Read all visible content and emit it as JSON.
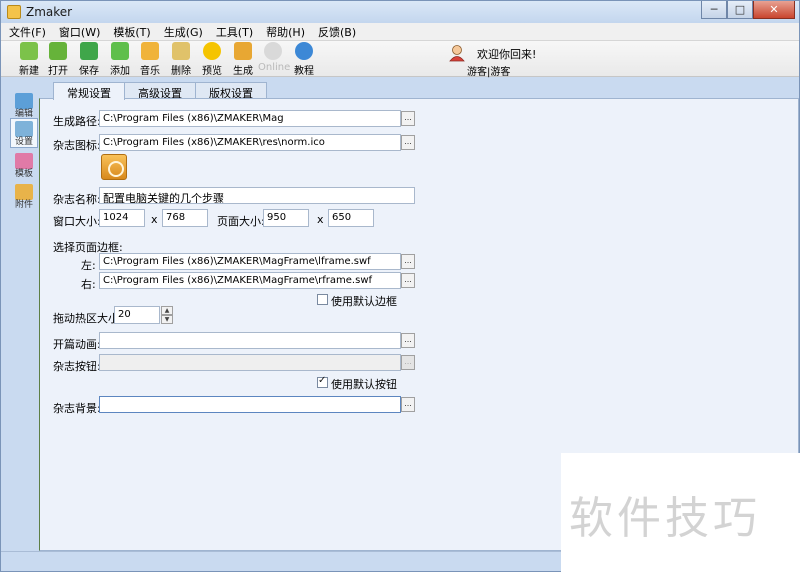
{
  "window": {
    "title": "Zmaker",
    "buttons": {
      "minimize": "─",
      "maximize": "□",
      "close": "✕"
    }
  },
  "menu": [
    "文件(F)",
    "窗口(W)",
    "模板(T)",
    "生成(G)",
    "工具(T)",
    "帮助(H)",
    "反馈(B)"
  ],
  "toolbar": [
    {
      "label": "新建",
      "icon": "new-icon",
      "color": "#7cc24a"
    },
    {
      "label": "打开",
      "icon": "open-icon",
      "color": "#66b33a"
    },
    {
      "label": "保存",
      "icon": "save-icon",
      "color": "#3fa64a"
    },
    {
      "label": "添加",
      "icon": "add-icon",
      "color": "#5fbf4c"
    },
    {
      "label": "音乐",
      "icon": "music-icon",
      "color": "#f0b33a"
    },
    {
      "label": "删除",
      "icon": "delete-icon",
      "color": "#e0c26a"
    },
    {
      "label": "预览",
      "icon": "star-icon",
      "color": "#f5c400"
    },
    {
      "label": "生成",
      "icon": "generate-icon",
      "color": "#e8a733"
    },
    {
      "label": "Online",
      "icon": "online-icon",
      "color": "#d9d9d9",
      "disabled": true
    },
    {
      "label": "教程",
      "icon": "help-icon",
      "color": "#3c88d6"
    }
  ],
  "user": {
    "welcome": "欢迎你回来!",
    "name": "游客|游客"
  },
  "sidebar": [
    {
      "label": "编辑",
      "icon": "edit-icon",
      "color": "#5c9fd8"
    },
    {
      "label": "设置",
      "icon": "settings-icon",
      "color": "#7eb2d9",
      "active": true
    },
    {
      "label": "模板",
      "icon": "template-icon",
      "color": "#e07aa7"
    },
    {
      "label": "附件",
      "icon": "attachment-icon",
      "color": "#e8b34a"
    }
  ],
  "tabs": [
    "常规设置",
    "高级设置",
    "版权设置"
  ],
  "form": {
    "output_path_label": "生成路径:",
    "output_path": "C:\\Program Files (x86)\\ZMAKER\\Mag",
    "icon_label": "杂志图标:",
    "icon_path": "C:\\Program Files (x86)\\ZMAKER\\res\\norm.ico",
    "name_label": "杂志名称:",
    "name_value": "配置电脑关键的几个步骤",
    "window_size_label": "窗口大小:",
    "window_w": "1024",
    "window_h": "768",
    "page_size_label": "页面大小:",
    "page_w": "950",
    "page_h": "650",
    "x": "x",
    "frame_label": "选择页面边框:",
    "left_label": "左:",
    "left_frame": "C:\\Program Files (x86)\\ZMAKER\\MagFrame\\lframe.swf",
    "right_label": "右:",
    "right_frame": "C:\\Program Files (x86)\\ZMAKER\\MagFrame\\rframe.swf",
    "default_frame_label": "使用默认边框",
    "default_frame_checked": false,
    "hotzone_label": "拖动热区大小:",
    "hotzone_value": "20",
    "opening_label": "开篇动画:",
    "opening_value": "",
    "buttons_label": "杂志按钮:",
    "buttons_value": "",
    "default_buttons_label": "使用默认按钮",
    "default_buttons_checked": true,
    "background_label": "杂志背景:",
    "background_value": "",
    "browse": "..."
  },
  "watermark": "软件技巧"
}
